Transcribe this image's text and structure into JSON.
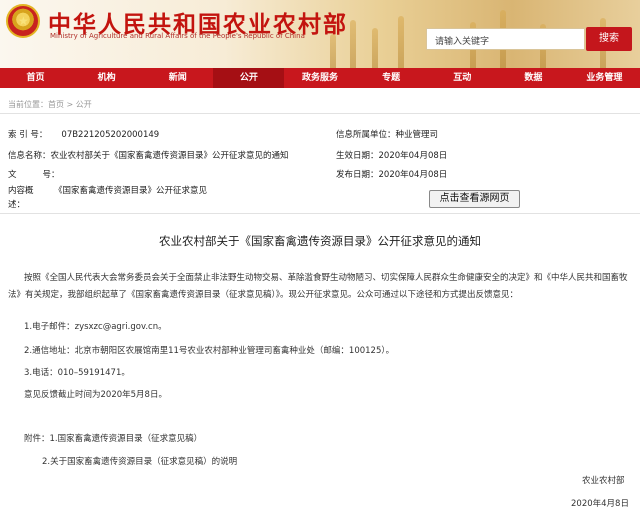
{
  "header": {
    "site_title": "中华人民共和国农业农村部",
    "site_subtitle": "Ministry of Agriculture and Rural Affairs of the People's Republic of China",
    "search_placeholder": "请输入关键字",
    "search_button": "搜索"
  },
  "nav": {
    "items": [
      {
        "label": "首页"
      },
      {
        "label": "机构"
      },
      {
        "label": "新闻"
      },
      {
        "label": "公开"
      },
      {
        "label": "政务服务"
      },
      {
        "label": "专题"
      },
      {
        "label": "互动"
      },
      {
        "label": "数据"
      },
      {
        "label": "业务管理"
      }
    ],
    "active_index": 3
  },
  "breadcrumb": {
    "prefix": "当前位置：",
    "home": "首页",
    "sep": " > ",
    "current": "公开"
  },
  "meta": {
    "index_label": "索 引 号：",
    "index_value": "07B221205202000149",
    "dept_label": "信息所属单位：",
    "dept_value": "种业管理司",
    "name_label": "信息名称：",
    "name_value": "农业农村部关于《国家畜禽遗传资源目录》公开征求意见的通知",
    "effective_label": "生效日期：",
    "effective_value": "2020年04月08日",
    "doc_label_1": "文",
    "doc_label_2": "号：",
    "doc_value": "",
    "publish_label": "发布日期：",
    "publish_value": "2020年04月08日",
    "summary_label_1": "内容概",
    "summary_label_2": "述：",
    "summary_value": "《国家畜禽遗传资源目录》公开征求意见",
    "view_source_button": "点击查看源网页"
  },
  "article": {
    "title": "农业农村部关于《国家畜禽遗传资源目录》公开征求意见的通知",
    "para1": "按照《全国人民代表大会常务委员会关于全面禁止非法野生动物交易、革除滥食野生动物陋习、切实保障人民群众生命健康安全的决定》和《中华人民共和国畜牧法》有关规定，我部组织起草了《国家畜禽遗传资源目录（征求意见稿）》。现公开征求意见。公众可通过以下途径和方式提出反馈意见：",
    "item1": "1.电子邮件：zysxzc@agri.gov.cn。",
    "item2": "2.通信地址：北京市朝阳区农展馆南里11号农业农村部种业管理司畜禽种业处（邮编：100125）。",
    "item3": "3.电话：010–59191471。",
    "deadline": "意见反馈截止时间为2020年5月8日。",
    "attach1": "附件：1.国家畜禽遗传资源目录（征求意见稿）",
    "attach2": "2.关于国家畜禽遗传资源目录（征求意见稿）的说明",
    "signer": "农业农村部",
    "date": "2020年4月8日"
  }
}
